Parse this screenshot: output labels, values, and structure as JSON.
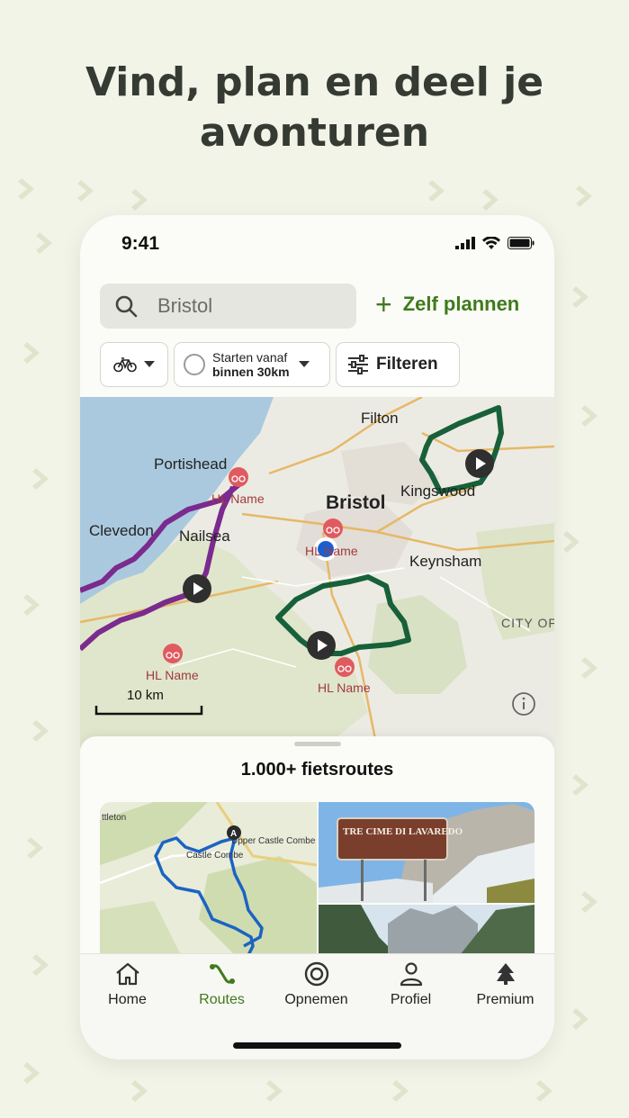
{
  "headline": {
    "line1": "Vind, plan en deel je",
    "line2": "avonturen"
  },
  "status_bar": {
    "time": "9:41",
    "icons": [
      "signal-icon",
      "wifi-icon",
      "battery-icon"
    ]
  },
  "search": {
    "icon": "search-icon",
    "value": "Bristol"
  },
  "plan_button": {
    "icon": "plus-icon",
    "label": "Zelf plannen"
  },
  "filters": {
    "activity": {
      "icon": "bike-icon"
    },
    "start": {
      "line1": "Starten vanaf",
      "line2": "binnen 30km"
    },
    "filter": {
      "icon": "sliders-icon",
      "label": "Filteren"
    }
  },
  "map": {
    "places": [
      "Filton",
      "Portishead",
      "Bristol",
      "Kingswood",
      "Clevedon",
      "Nailsea",
      "Keynsham",
      "CITY OF"
    ],
    "pois": [
      "HL Name",
      "HL Name",
      "HL Name",
      "HL Name"
    ],
    "scale": "10 km",
    "route_colors": {
      "purple": "#7b2a8e",
      "green": "#17603a"
    }
  },
  "sheet": {
    "title": "1.000+ fietsroutes",
    "card_map_labels": [
      "ttleton",
      "Upper Castle Combe",
      "Castle Combe"
    ],
    "card_map_marker": "A",
    "photo_sign_text": "TRE CIME DI LAVAREDO"
  },
  "tabs": [
    {
      "label": "Home",
      "icon": "home-icon",
      "active": false
    },
    {
      "label": "Routes",
      "icon": "routes-icon",
      "active": true
    },
    {
      "label": "Opnemen",
      "icon": "record-icon",
      "active": false
    },
    {
      "label": "Profiel",
      "icon": "profile-icon",
      "active": false
    },
    {
      "label": "Premium",
      "icon": "premium-icon",
      "active": false
    }
  ],
  "colors": {
    "accent": "#3f7a1c",
    "background": "#f2f4e8",
    "pin": "#e05a5f",
    "location": "#1a5fd1"
  }
}
